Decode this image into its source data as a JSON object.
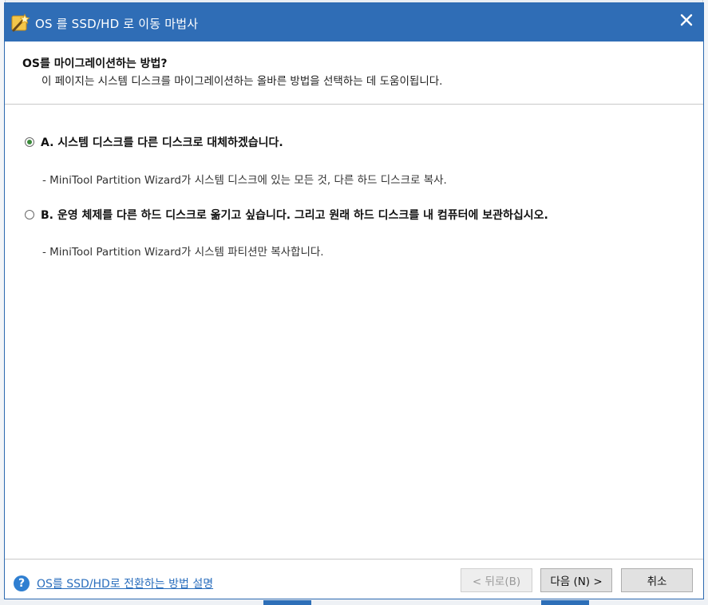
{
  "window": {
    "title": "OS 를 SSD/HD 로 이동 마법사",
    "icon": "wizard-wand-icon",
    "close_icon": "close-icon",
    "titlebar_color": "#2f6db6"
  },
  "header": {
    "heading": "OS를 마이그레이션하는 방법?",
    "subheading": "이 페이지는 시스템 디스크를 마이그레이션하는 올바른 방법을 선택하는 데 도움이됩니다."
  },
  "options": [
    {
      "label": "A. 시스템 디스크를 다른 디스크로 대체하겠습니다.",
      "description": "- MiniTool Partition Wizard가 시스템 디스크에 있는 모든 것, 다른 하드 디스크로 복사.",
      "selected": true
    },
    {
      "label": "B. 운영 체제를 다른 하드 디스크로 옮기고 싶습니다. 그리고 원래 하드 디스크를 내 컴퓨터에 보관하십시오.",
      "description": "- MiniTool Partition Wizard가 시스템 파티션만 복사합니다.",
      "selected": false
    }
  ],
  "footer": {
    "help_icon": "help-icon",
    "help_link": "OS를 SSD/HD로 전환하는 방법 설명",
    "back_label": "< 뒤로(B)",
    "next_label": "다음 (N) >",
    "cancel_label": "취소"
  }
}
